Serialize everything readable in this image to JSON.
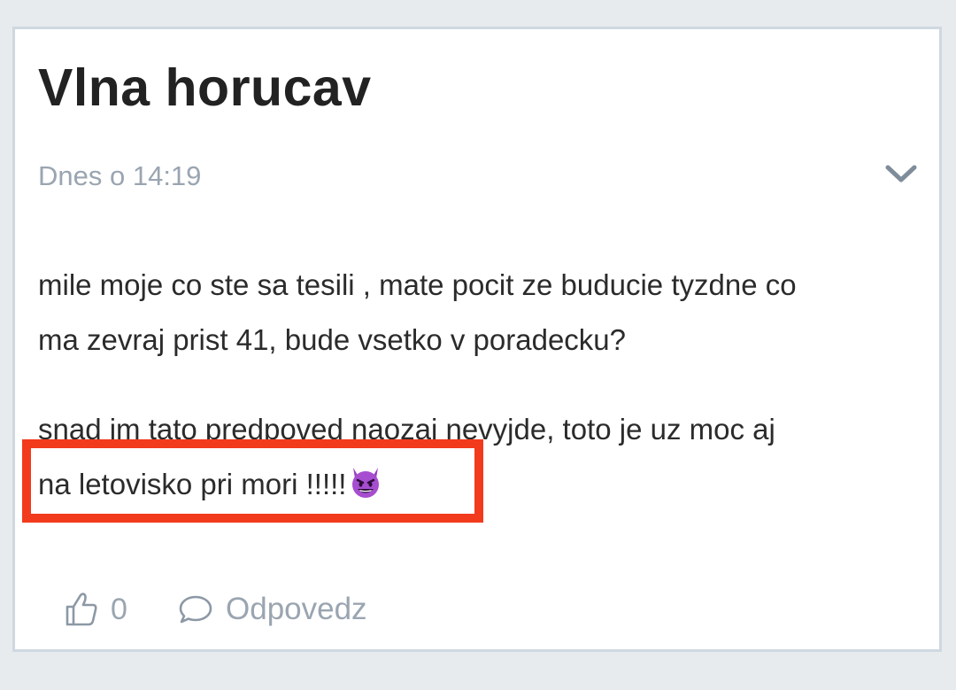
{
  "post": {
    "title": "Vlna horucav",
    "date": "Dnes o 14:19",
    "paragraph_1_line_1": "mile moje co ste sa tesili , mate pocit ze buducie tyzdne co",
    "paragraph_1_line_2": "ma zevraj prist 41, bude vsetko v poradecku?",
    "paragraph_2_line_1": "snad im tato predpoved naozaj nevyjde, toto je uz moc aj",
    "paragraph_2_line_2": "na letovisko pri mori !!!!!",
    "emoji": "smiling-devil-emoji"
  },
  "actions": {
    "like_count": "0",
    "reply_label": "Odpovedz"
  },
  "colors": {
    "highlight": "#f23a1d",
    "muted": "#9aa5b1",
    "card_border": "#cfd8e1",
    "background": "#e8ebee"
  }
}
